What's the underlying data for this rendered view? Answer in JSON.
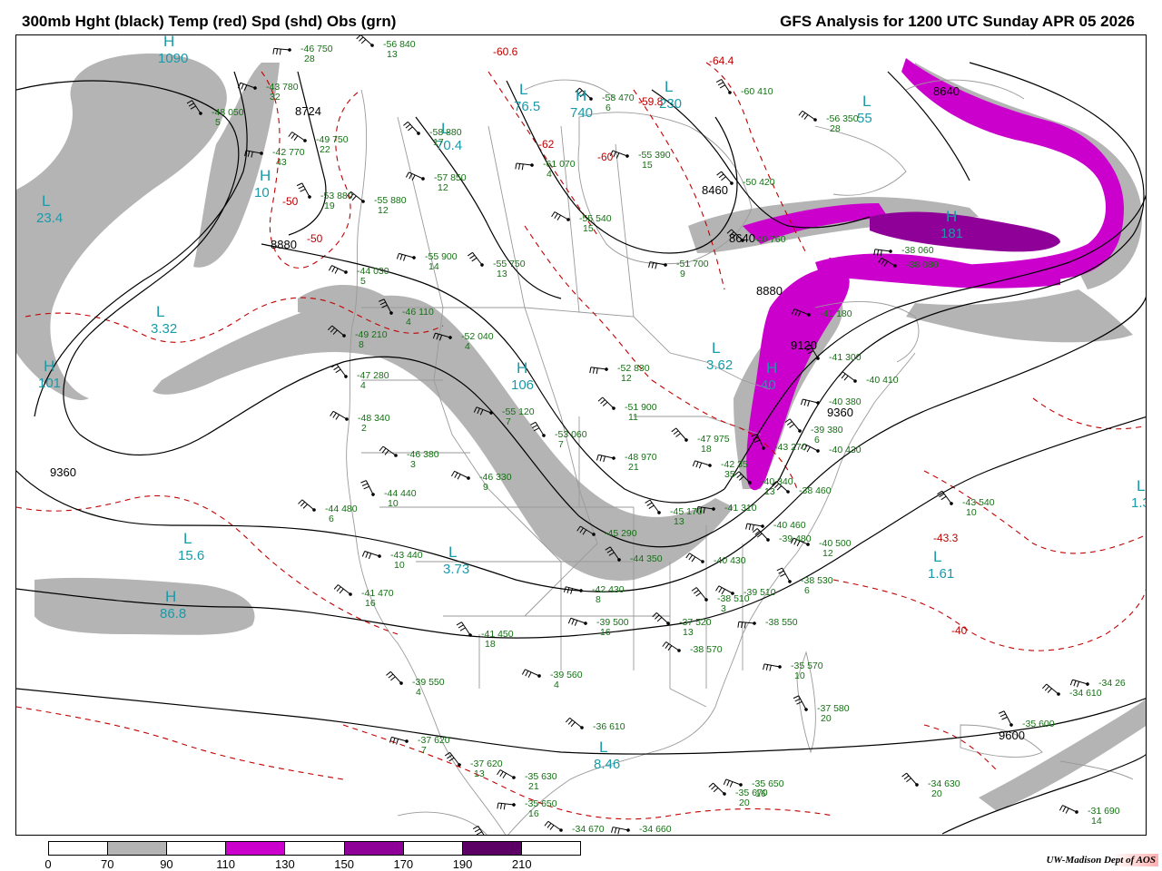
{
  "header": {
    "title_left": "300mb Hght (black) Temp (red) Spd (shd) Obs (grn)",
    "title_right": "GFS Analysis for 1200 UTC Sunday  APR 05 2026"
  },
  "colors": {
    "height_contour": "#000000",
    "temperature_contour": "#c00000",
    "obs": "#157015",
    "high_low": "#1a9aa8",
    "boundaries": "#9a9a9a",
    "speed_70_90": "#b4b4b4",
    "speed_110_130": "#cc00cc",
    "speed_150_170": "#8f0099",
    "speed_190_210": "#5c0066"
  },
  "legend": {
    "ticks": [
      "0",
      "70",
      "90",
      "110",
      "130",
      "150",
      "170",
      "190",
      "210"
    ],
    "colors": [
      "#ffffff",
      "#b4b4b4",
      "#ffffff",
      "#cc00cc",
      "#ffffff",
      "#8f0099",
      "#ffffff",
      "#5c0066",
      "#ffffff"
    ]
  },
  "credit": "UW-Madison  Dept of AOS",
  "height_labels": [
    "8640",
    "8724",
    "8880",
    "8460",
    "8640",
    "8880",
    "9120",
    "9360",
    "9360",
    "9600"
  ],
  "temperature_labels": [
    "-60.6",
    "-64.4",
    "-59.8",
    "-62",
    "-60",
    "-50",
    "-50",
    "-40",
    "-43.3"
  ],
  "centers": [
    {
      "letter": "L",
      "value": "23.4"
    },
    {
      "letter": "H",
      "value": "10"
    },
    {
      "letter": "L",
      "value": "3.32"
    },
    {
      "letter": "H",
      "value": "101"
    },
    {
      "letter": "L",
      "value": "15.6"
    },
    {
      "letter": "H",
      "value": "86.8"
    },
    {
      "letter": "L",
      "value": "3.73"
    },
    {
      "letter": "H",
      "value": "106"
    },
    {
      "letter": "L",
      "value": "3.62"
    },
    {
      "letter": "H",
      "value": "40"
    },
    {
      "letter": "L",
      "value": "8.46"
    },
    {
      "letter": "L",
      "value": "1.61"
    },
    {
      "letter": "L",
      "value": "1.33"
    },
    {
      "letter": "H",
      "value": "181"
    },
    {
      "letter": "L",
      "value": "230"
    },
    {
      "letter": "L",
      "value": "55"
    },
    {
      "letter": "H",
      "value": "1090"
    },
    {
      "letter": "L",
      "value": "76.5"
    },
    {
      "letter": "H",
      "value": "740"
    },
    {
      "letter": "L",
      "value": "70.4"
    }
  ],
  "obs": [
    {
      "t": "-46",
      "h": "750",
      "d": "28"
    },
    {
      "t": "-56",
      "h": "840",
      "d": "13"
    },
    {
      "t": "-43",
      "h": "780",
      "d": "32"
    },
    {
      "t": "-48",
      "h": "050",
      "d": "5"
    },
    {
      "t": "-49",
      "h": "750",
      "d": "22"
    },
    {
      "t": "-42",
      "h": "770",
      "d": "43"
    },
    {
      "t": "-58",
      "h": "880",
      "d": "17"
    },
    {
      "t": "-57",
      "h": "850",
      "d": "12"
    },
    {
      "t": "-53",
      "h": "880",
      "d": "19"
    },
    {
      "t": "-55",
      "h": "880",
      "d": "12"
    },
    {
      "t": "-55",
      "h": "900",
      "d": "14"
    },
    {
      "t": "-55",
      "h": "750",
      "d": "13"
    },
    {
      "t": "-55",
      "h": "540",
      "d": "15"
    },
    {
      "t": "-61",
      "h": "070",
      "d": "4"
    },
    {
      "t": "-58",
      "h": "470",
      "d": "6"
    },
    {
      "t": "-55",
      "h": "390",
      "d": "15"
    },
    {
      "t": "-60",
      "h": "410",
      "d": ""
    },
    {
      "t": "-56",
      "h": "350",
      "d": "28"
    },
    {
      "t": "-51",
      "h": "700",
      "d": "9"
    },
    {
      "t": "-50",
      "h": "420",
      "d": ""
    },
    {
      "t": "-44",
      "h": "030",
      "d": "5"
    },
    {
      "t": "-46",
      "h": "110",
      "d": "4"
    },
    {
      "t": "-49",
      "h": "210",
      "d": "8"
    },
    {
      "t": "-52",
      "h": "040",
      "d": "4"
    },
    {
      "t": "-47",
      "h": "280",
      "d": "4"
    },
    {
      "t": "-48",
      "h": "340",
      "d": "2"
    },
    {
      "t": "-52",
      "h": "830",
      "d": "12"
    },
    {
      "t": "-51",
      "h": "900",
      "d": "11"
    },
    {
      "t": "-55",
      "h": "120",
      "d": "7"
    },
    {
      "t": "-53",
      "h": "060",
      "d": "7"
    },
    {
      "t": "-46",
      "h": "380",
      "d": "3"
    },
    {
      "t": "-48",
      "h": "970",
      "d": "21"
    },
    {
      "t": "-47",
      "h": "975",
      "d": "18"
    },
    {
      "t": "-46",
      "h": "330",
      "d": "9"
    },
    {
      "t": "-44",
      "h": "440",
      "d": "10"
    },
    {
      "t": "-44",
      "h": "480",
      "d": "6"
    },
    {
      "t": "-42",
      "h": "35",
      "d": "35"
    },
    {
      "t": "-45",
      "h": "170",
      "d": "13"
    },
    {
      "t": "-45",
      "h": "290",
      "d": ""
    },
    {
      "t": "-41",
      "h": "310",
      "d": ""
    },
    {
      "t": "-40",
      "h": "340",
      "d": "13"
    },
    {
      "t": "-41",
      "h": "180",
      "d": ""
    },
    {
      "t": "-41",
      "h": "300",
      "d": ""
    },
    {
      "t": "-40",
      "h": "410",
      "d": ""
    },
    {
      "t": "-40",
      "h": "380",
      "d": ""
    },
    {
      "t": "-39",
      "h": "380",
      "d": "6"
    },
    {
      "t": "-40",
      "h": "430",
      "d": ""
    },
    {
      "t": "-43",
      "h": "270",
      "d": ""
    },
    {
      "t": "-38",
      "h": "460",
      "d": ""
    },
    {
      "t": "-43",
      "h": "440",
      "d": "10"
    },
    {
      "t": "-44",
      "h": "350",
      "d": ""
    },
    {
      "t": "-40",
      "h": "430",
      "d": ""
    },
    {
      "t": "-40",
      "h": "460",
      "d": ""
    },
    {
      "t": "-39",
      "h": "480",
      "d": ""
    },
    {
      "t": "-40",
      "h": "500",
      "d": "12"
    },
    {
      "t": "-38",
      "h": "530",
      "d": "6"
    },
    {
      "t": "-41",
      "h": "470",
      "d": "16"
    },
    {
      "t": "-42",
      "h": "430",
      "d": "8"
    },
    {
      "t": "-38",
      "h": "510",
      "d": "3"
    },
    {
      "t": "-39",
      "h": "510",
      "d": ""
    },
    {
      "t": "-38",
      "h": "550",
      "d": ""
    },
    {
      "t": "-37",
      "h": "520",
      "d": "13"
    },
    {
      "t": "-39",
      "h": "500",
      "d": "16"
    },
    {
      "t": "-41",
      "h": "450",
      "d": "18"
    },
    {
      "t": "-38",
      "h": "570",
      "d": ""
    },
    {
      "t": "-35",
      "h": "570",
      "d": "10"
    },
    {
      "t": "-39",
      "h": "550",
      "d": "4"
    },
    {
      "t": "-39",
      "h": "560",
      "d": "4"
    },
    {
      "t": "-37",
      "h": "580",
      "d": "20"
    },
    {
      "t": "-36",
      "h": "610",
      "d": ""
    },
    {
      "t": "-37",
      "h": "620",
      "d": "7"
    },
    {
      "t": "-37",
      "h": "620",
      "d": "13"
    },
    {
      "t": "-35",
      "h": "630",
      "d": "21"
    },
    {
      "t": "-35",
      "h": "650",
      "d": "16"
    },
    {
      "t": "-35",
      "h": "670",
      "d": "20"
    },
    {
      "t": "-35",
      "h": "650",
      "d": "16"
    },
    {
      "t": "-35",
      "h": "670",
      "d": ""
    },
    {
      "t": "-34",
      "h": "670",
      "d": ""
    },
    {
      "t": "-34",
      "h": "660",
      "d": ""
    },
    {
      "t": "-34",
      "h": "630",
      "d": "20"
    },
    {
      "t": "-31",
      "h": "690",
      "d": "14"
    },
    {
      "t": "-35",
      "h": "600",
      "d": ""
    },
    {
      "t": "-34",
      "h": "610",
      "d": ""
    },
    {
      "t": "-34",
      "h": "26",
      "d": ""
    },
    {
      "t": "-43",
      "h": "540",
      "d": "10"
    },
    {
      "t": "-38",
      "h": "080",
      "d": ""
    },
    {
      "t": "-38",
      "h": "060",
      "d": ""
    },
    {
      "t": "-40",
      "h": "760",
      "d": ""
    }
  ]
}
